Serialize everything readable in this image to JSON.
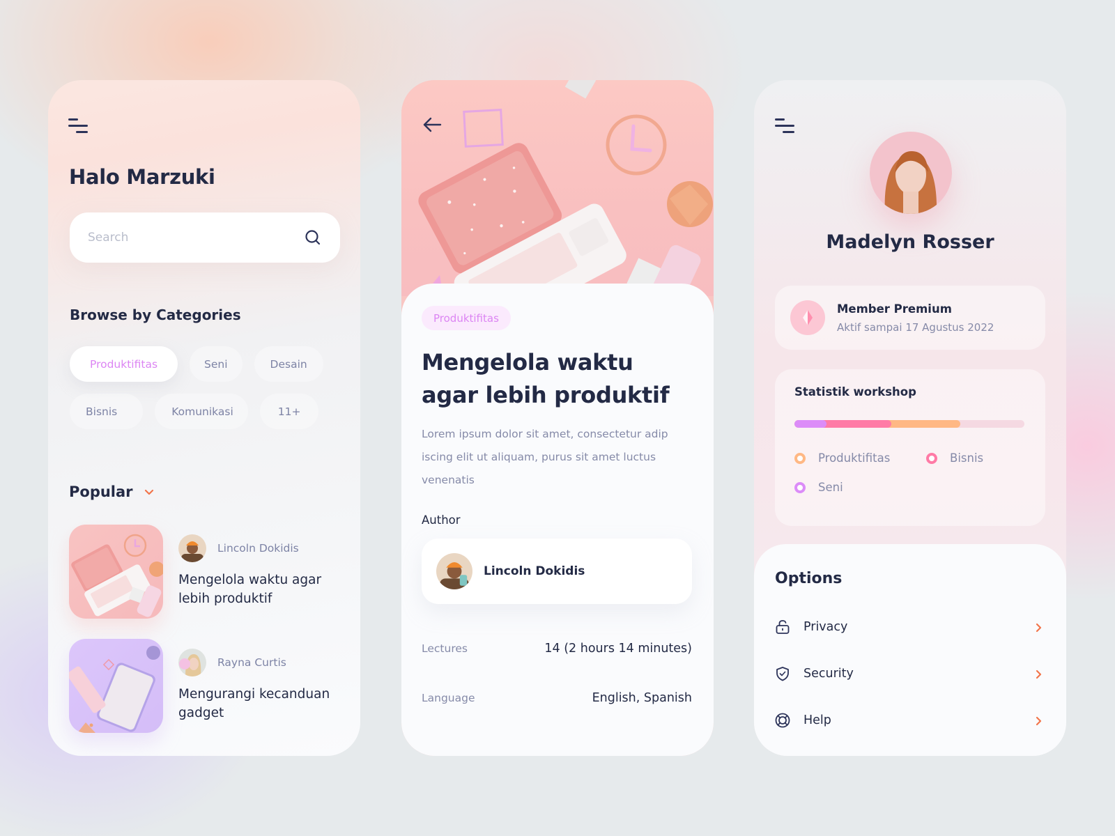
{
  "home": {
    "greeting": "Halo Marzuki",
    "search": {
      "placeholder": "Search",
      "value": ""
    },
    "categories_title": "Browse by Categories",
    "categories": [
      "Produktifitas",
      "Seni",
      "Desain",
      "Bisnis",
      "Komunikasi",
      "11+"
    ],
    "active_category": "Produktifitas",
    "popular_title": "Popular",
    "popular": [
      {
        "author": "Lincoln Dokidis",
        "title": "Mengelola waktu agar lebih produktif",
        "thumb": "pink-laptop-illustration"
      },
      {
        "author": "Rayna Curtis",
        "title": "Mengurangi kecanduan gadget",
        "thumb": "purple-phone-illustration"
      }
    ]
  },
  "detail": {
    "hero": "pink-laptop-illustration",
    "tag": "Produktifitas",
    "title": "Mengelola waktu agar lebih produktif",
    "description": "Lorem ipsum dolor sit amet, consectetur adip iscing elit ut aliquam, purus sit amet luctus venenatis",
    "author_label": "Author",
    "author_name": "Lincoln Dokidis",
    "lectures_label": "Lectures",
    "lectures_value": "14 (2 hours 14  minutes)",
    "language_label": "Language",
    "language_value": "English, Spanish"
  },
  "profile": {
    "name": "Madelyn Rosser",
    "member": {
      "title": "Member Premium",
      "subtitle": "Aktif sampai 17 Agustus 2022"
    },
    "stats": {
      "title": "Statistik workshop",
      "segments": [
        {
          "name": "Seni",
          "share": 0.14,
          "color": "#dc8cf8"
        },
        {
          "name": "Bisnis",
          "share": 0.28,
          "color": "#ff7ba6"
        },
        {
          "name": "Produktifitas",
          "share": 0.3,
          "color": "#ffb884"
        }
      ],
      "legend": [
        {
          "name": "Produktifitas",
          "color": "#ffb884"
        },
        {
          "name": "Bisnis",
          "color": "#ff7ba6"
        },
        {
          "name": "Seni",
          "color": "#dc8cf8"
        }
      ]
    },
    "options_title": "Options",
    "options": [
      {
        "label": "Privacy",
        "icon": "lock-icon"
      },
      {
        "label": "Security",
        "icon": "shield-check-icon"
      },
      {
        "label": "Help",
        "icon": "lifebuoy-icon"
      }
    ]
  },
  "colors": {
    "text_dark": "#232a45",
    "text_muted": "#858aa8",
    "accent_purple": "#dc85f3",
    "accent_orange": "#f2754b",
    "pink_bg": "#f9c6c3"
  }
}
